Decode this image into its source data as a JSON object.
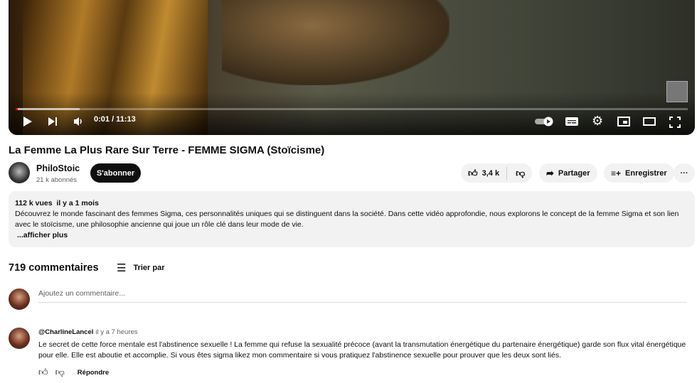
{
  "player": {
    "time": "0:01 / 11:13",
    "progress_percent": 0.15,
    "buffered_percent": 9.5
  },
  "video": {
    "title": "La Femme La Plus Rare Sur Terre - FEMME SIGMA (Stoïcisme)"
  },
  "channel": {
    "name": "PhiloStoic",
    "subscribers": "21 k abonnés",
    "subscribe_label": "S'abonner"
  },
  "actions": {
    "likes": "3,4 k",
    "share": "Partager",
    "save": "Enregistrer",
    "more": "···"
  },
  "description": {
    "views": "112 k vues",
    "date": "il y a 1 mois",
    "text": "Découvrez le monde fascinant des femmes Sigma, ces personnalités uniques qui se distinguent dans la société. Dans cette vidéo approfondie, nous explorons le concept de la femme Sigma et son lien avec le stoïcisme, une philosophie ancienne qui joue un rôle clé dans leur mode de vie.",
    "more": "...afficher plus"
  },
  "comments": {
    "count": "719 commentaires",
    "sort": "Trier par",
    "placeholder": "Ajoutez un commentaire...",
    "items": [
      {
        "author": "@CharlineLancel",
        "time": "il y a 7 heures",
        "text": "Le secret de cette force mentale est l'abstinence sexuelle ! La femme qui refuse la sexualité précoce (avant la transmutation énergétique du partenaire énergétique) garde son flux vital énergétique pour elle. Elle est aboutie et accomplie. Si vous êtes sigma likez mon commentaire si vous pratiquez l'abstinence sexuelle pour prouver que les deux sont liés.",
        "reply": "Répondre"
      }
    ]
  }
}
